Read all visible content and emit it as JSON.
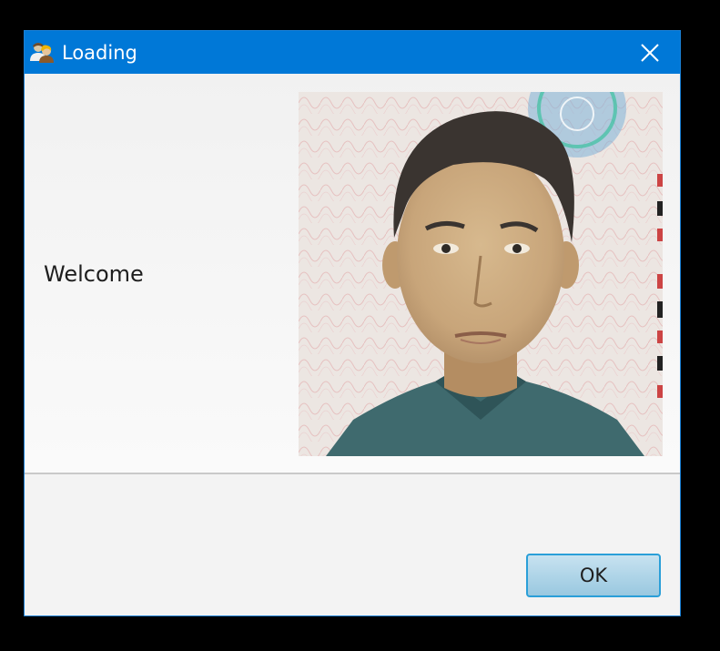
{
  "window": {
    "title": "Loading",
    "icon": "users-icon",
    "close_icon": "close-icon"
  },
  "content": {
    "message": "Welcome",
    "photo": "id-portrait-photo"
  },
  "footer": {
    "ok_label": "OK"
  },
  "colors": {
    "titlebar": "#0078d7",
    "button_border": "#2a9fd8",
    "button_fill": "#b3d7ea",
    "background": "#f4f4f4"
  }
}
